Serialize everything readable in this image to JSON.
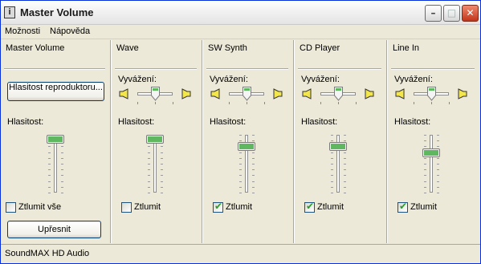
{
  "window": {
    "title": "Master Volume"
  },
  "menu": {
    "items": [
      "Možnosti",
      "Nápověda"
    ]
  },
  "master": {
    "title": "Master Volume",
    "speaker_button": "Hlasitost reproduktoru...",
    "volume_label": "Hlasitost:",
    "volume_level": 0.93,
    "mute_label": "Ztlumit vše",
    "mute_checked": false,
    "advanced_button": "Upřesnit"
  },
  "channels": [
    {
      "title": "Wave",
      "balance_label": "Vyvážení:",
      "volume_label": "Hlasitost:",
      "volume_level": 0.93,
      "mute_label": "Ztlumit",
      "mute_checked": false
    },
    {
      "title": "SW Synth",
      "balance_label": "Vyvážení:",
      "volume_label": "Hlasitost:",
      "volume_level": 0.8,
      "mute_label": "Ztlumit",
      "mute_checked": true
    },
    {
      "title": "CD Player",
      "balance_label": "Vyvážení:",
      "volume_label": "Hlasitost:",
      "volume_level": 0.8,
      "mute_label": "Ztlumit",
      "mute_checked": true
    },
    {
      "title": "Line In",
      "balance_label": "Vyvážení:",
      "volume_label": "Hlasitost:",
      "volume_level": 0.69,
      "mute_label": "Ztlumit",
      "mute_checked": true
    }
  ],
  "statusbar": {
    "text": "SoundMAX HD Audio"
  },
  "icons": {
    "app": "mixer-icon",
    "speaker_left": "speaker-left-icon",
    "speaker_right": "speaker-right-icon",
    "minimize": "minimize-icon",
    "maximize": "maximize-icon",
    "close": "close-icon"
  },
  "colors": {
    "window_border": "#0831d9",
    "face": "#ece9d8",
    "close_button": "#c2351b",
    "thumb_green": "#5fb85f"
  }
}
